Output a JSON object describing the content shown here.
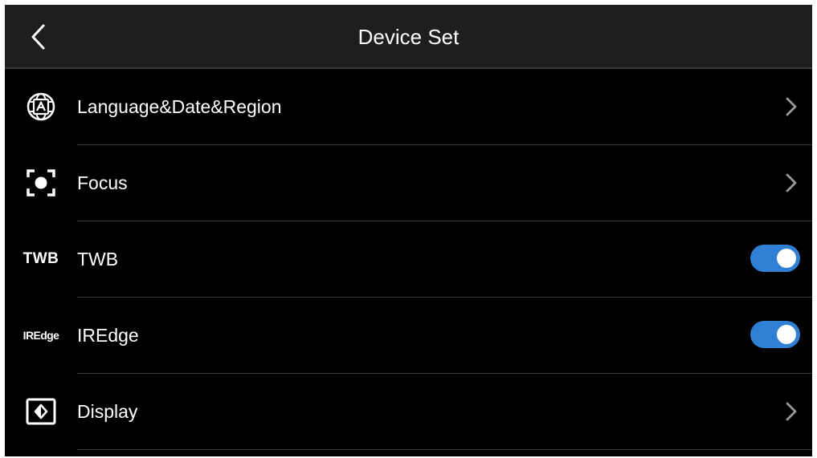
{
  "header": {
    "title": "Device Set",
    "back_icon": "chevron-left-icon"
  },
  "settings": [
    {
      "label": "Language&Date&Region",
      "icon": "globe-language-icon",
      "control": "chevron"
    },
    {
      "label": "Focus",
      "icon": "focus-icon",
      "control": "chevron"
    },
    {
      "label": "TWB",
      "icon_text": "TWB",
      "control": "toggle",
      "enabled": true
    },
    {
      "label": "IREdge",
      "icon_text": "IREdge",
      "control": "toggle",
      "enabled": true
    },
    {
      "label": "Display",
      "icon": "display-brightness-icon",
      "control": "chevron"
    }
  ],
  "colors": {
    "background": "#000000",
    "header": "#1e1e1e",
    "toggle_on": "#2f7fd4",
    "divider": "#3b3b3b",
    "chevron": "#9a9a9a"
  }
}
